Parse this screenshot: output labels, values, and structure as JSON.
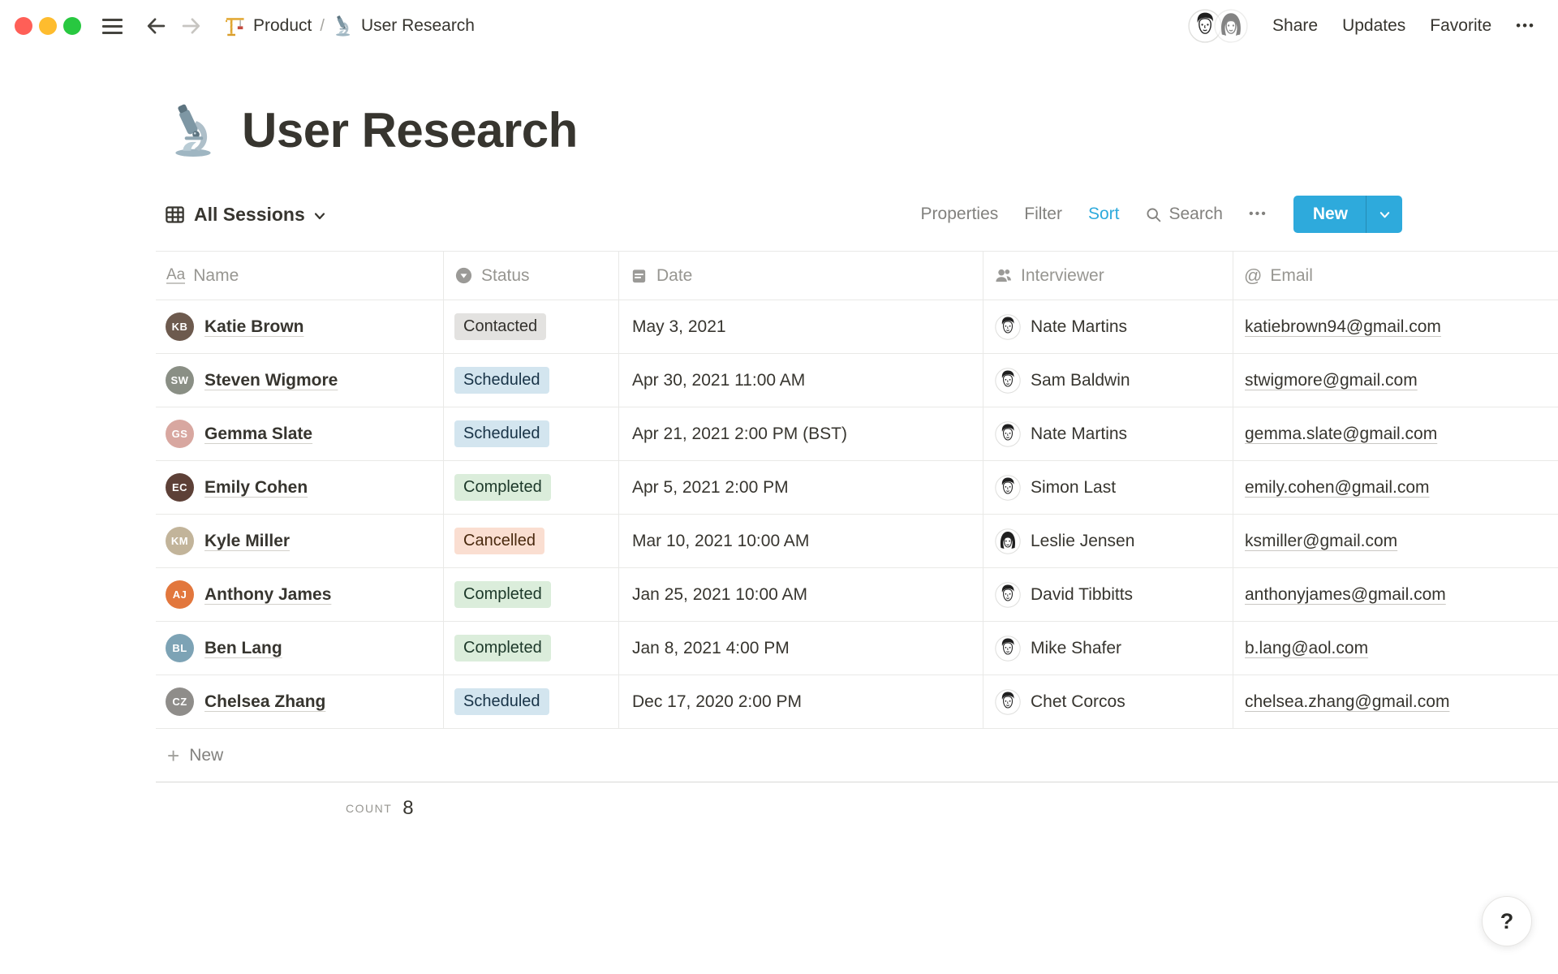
{
  "colors": {
    "accent": "#2EAADC",
    "text": "#37352F",
    "text-gray": "#82817E",
    "header-gray": "#979691",
    "border": "#E9E9E7",
    "border-strong": "#D9D8D6",
    "underline": "#D3D1CB",
    "traffic-red": "#FF5F57",
    "traffic-yellow": "#FEBC2E",
    "traffic-green": "#28C840",
    "badge-contacted-bg": "#E3E2E0",
    "badge-contacted-text": "#32302C",
    "badge-scheduled-bg": "#D3E5EF",
    "badge-scheduled-text": "#183347",
    "badge-completed-bg": "#DBEDDB",
    "badge-completed-text": "#1C3829",
    "badge-cancelled-bg": "#FADED1",
    "badge-cancelled-text": "#49290E"
  },
  "topbar": {
    "breadcrumb": {
      "workspace_label": "Product",
      "separator": "/",
      "page_label": "User Research"
    },
    "share_label": "Share",
    "updates_label": "Updates",
    "favorite_label": "Favorite",
    "more_label": "•••"
  },
  "page": {
    "title": "User Research"
  },
  "view_bar": {
    "view_name": "All Sessions",
    "properties_label": "Properties",
    "filter_label": "Filter",
    "sort_label": "Sort",
    "search_label": "Search",
    "more_label": "•••",
    "new_label": "New"
  },
  "table": {
    "columns": [
      {
        "label": "Name",
        "icon": "text-aa-icon",
        "glyph": "Aa"
      },
      {
        "label": "Status",
        "icon": "select-icon"
      },
      {
        "label": "Date",
        "icon": "calendar-icon"
      },
      {
        "label": "Interviewer",
        "icon": "person-icon"
      },
      {
        "label": "Email",
        "icon": "at-icon",
        "glyph": "@"
      }
    ],
    "rows": [
      {
        "name": "Katie Brown",
        "avatar_initials": "KB",
        "avatar_color": "#6D5A4E",
        "status": "Contacted",
        "date": "May 3, 2021",
        "interviewer": "Nate Martins",
        "interviewer_avatar": "short-hair",
        "email": "katiebrown94@gmail.com"
      },
      {
        "name": "Steven Wigmore",
        "avatar_initials": "SW",
        "avatar_color": "#8A8F85",
        "status": "Scheduled",
        "date": "Apr 30, 2021 11:00 AM",
        "interviewer": "Sam Baldwin",
        "interviewer_avatar": "short-hair",
        "email": "stwigmore@gmail.com"
      },
      {
        "name": "Gemma Slate",
        "avatar_initials": "GS",
        "avatar_color": "#D8A7A0",
        "status": "Scheduled",
        "date": "Apr 21, 2021 2:00 PM (BST)",
        "interviewer": "Nate Martins",
        "interviewer_avatar": "short-hair",
        "email": "gemma.slate@gmail.com"
      },
      {
        "name": "Emily Cohen",
        "avatar_initials": "EC",
        "avatar_color": "#5D4037",
        "status": "Completed",
        "date": "Apr 5, 2021 2:00 PM",
        "interviewer": "Simon Last",
        "interviewer_avatar": "short-hair",
        "email": "emily.cohen@gmail.com"
      },
      {
        "name": "Kyle Miller",
        "avatar_initials": "KM",
        "avatar_color": "#C2B49A",
        "status": "Cancelled",
        "date": "Mar 10, 2021 10:00 AM",
        "interviewer": "Leslie Jensen",
        "interviewer_avatar": "long-hair",
        "email": "ksmiller@gmail.com"
      },
      {
        "name": "Anthony James",
        "avatar_initials": "AJ",
        "avatar_color": "#E2773D",
        "status": "Completed",
        "date": "Jan 25, 2021 10:00 AM",
        "interviewer": "David Tibbitts",
        "interviewer_avatar": "short-hair",
        "email": "anthonyjames@gmail.com"
      },
      {
        "name": "Ben Lang",
        "avatar_initials": "BL",
        "avatar_color": "#7DA3B5",
        "status": "Completed",
        "date": "Jan 8, 2021 4:00 PM",
        "interviewer": "Mike Shafer",
        "interviewer_avatar": "short-hair",
        "email": "b.lang@aol.com"
      },
      {
        "name": "Chelsea Zhang",
        "avatar_initials": "CZ",
        "avatar_color": "#8F8D8A",
        "status": "Scheduled",
        "date": "Dec 17, 2020 2:00 PM",
        "interviewer": "Chet Corcos",
        "interviewer_avatar": "short-hair",
        "email": "chelsea.zhang@gmail.com"
      }
    ],
    "new_row_label": "New",
    "count_label": "COUNT",
    "count_value": "8"
  },
  "help_label": "?"
}
